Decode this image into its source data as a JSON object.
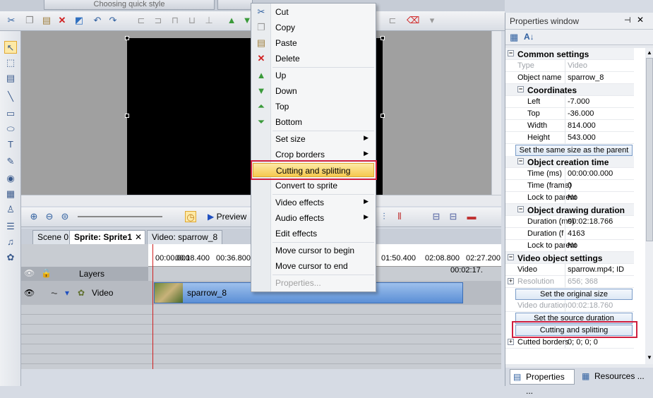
{
  "header": {
    "quick_style_label": "Choosing quick style"
  },
  "context_menu": {
    "items": [
      {
        "label": "Cut",
        "icon": "scissors-icon"
      },
      {
        "label": "Copy",
        "icon": "copy-icon"
      },
      {
        "label": "Paste",
        "icon": "paste-icon"
      },
      {
        "label": "Delete",
        "icon": "delete-icon"
      },
      {
        "label": "Up",
        "icon": "arrow-up-icon"
      },
      {
        "label": "Down",
        "icon": "arrow-down-icon"
      },
      {
        "label": "Top",
        "icon": "arrow-top-icon"
      },
      {
        "label": "Bottom",
        "icon": "arrow-bottom-icon"
      },
      {
        "label": "Set size"
      },
      {
        "label": "Crop borders"
      },
      {
        "label": "Cutting and splitting"
      },
      {
        "label": "Convert to sprite"
      },
      {
        "label": "Video effects"
      },
      {
        "label": "Audio effects"
      },
      {
        "label": "Edit effects"
      },
      {
        "label": "Move cursor to begin"
      },
      {
        "label": "Move cursor to end"
      },
      {
        "label": "Properties..."
      }
    ]
  },
  "timeline": {
    "tabs": [
      "Scene 0",
      "Sprite: Sprite1",
      "Video: sparrow_8"
    ],
    "ruler_ticks": [
      "00:00.000",
      "00:18.400",
      "00:36.800",
      "01:50.400",
      "02:08.800",
      "02:27.200"
    ],
    "end_time": "00:02:17.",
    "layers_label": "Layers",
    "track_label": "Video",
    "clip_label": "sparrow_8",
    "preview_label": "Preview"
  },
  "properties": {
    "title": "Properties window",
    "sections": {
      "common": "Common settings",
      "coordinates": "Coordinates",
      "creation": "Object creation time",
      "drawing": "Object drawing duration",
      "video": "Video object settings"
    },
    "rows": {
      "type": {
        "name": "Type",
        "value": "Video"
      },
      "object_name": {
        "name": "Object name",
        "value": "sparrow_8"
      },
      "left": {
        "name": "Left",
        "value": "-7.000"
      },
      "top": {
        "name": "Top",
        "value": "-36.000"
      },
      "width": {
        "name": "Width",
        "value": "814.000"
      },
      "height": {
        "name": "Height",
        "value": "543.000"
      },
      "time_ms": {
        "name": "Time (ms)",
        "value": "00:00:00.000"
      },
      "time_frame": {
        "name": "Time (frame)",
        "value": "0"
      },
      "lock_parent_1": {
        "name": "Lock to parent",
        "value": "No"
      },
      "duration_ms": {
        "name": "Duration (ms)",
        "value": "00:02:18.766"
      },
      "duration_frame": {
        "name": "Duration (fram",
        "value": "4163"
      },
      "lock_parent_2": {
        "name": "Lock to parent",
        "value": "No"
      },
      "video": {
        "name": "Video",
        "value": "sparrow.mp4; ID"
      },
      "resolution": {
        "name": "Resolution",
        "value": "656; 368"
      },
      "video_duration": {
        "name": "Video duration",
        "value": "00:02:18.760"
      },
      "cutted_borders": {
        "name": "Cutted borders",
        "value": "0; 0; 0; 0"
      }
    },
    "buttons": {
      "same_size": "Set the same size as the parent has",
      "original_size": "Set the original size",
      "source_duration": "Set the source duration",
      "cutting": "Cutting and splitting"
    },
    "bottom_tabs": [
      "Properties ...",
      "Resources ..."
    ]
  }
}
